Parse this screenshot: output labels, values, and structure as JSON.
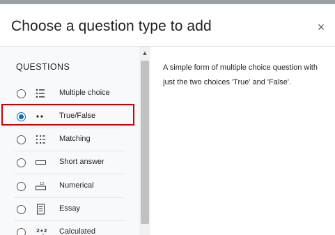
{
  "dialog": {
    "title": "Choose a question type to add",
    "close_glyph": "×"
  },
  "list": {
    "section_label": "QUESTIONS",
    "selected_index": 1,
    "items": [
      {
        "label": "Multiple choice",
        "icon": "list-icon",
        "selected": false
      },
      {
        "label": "True/False",
        "icon": "two-dots-icon",
        "selected": true
      },
      {
        "label": "Matching",
        "icon": "grid-dots-icon",
        "selected": false
      },
      {
        "label": "Short answer",
        "icon": "input-box-icon",
        "selected": false
      },
      {
        "label": "Numerical",
        "icon": "numerical-icon",
        "selected": false
      },
      {
        "label": "Essay",
        "icon": "document-icon",
        "selected": false
      },
      {
        "label": "Calculated",
        "icon": "calculator-icon",
        "selected": false
      }
    ]
  },
  "description": {
    "text": "A simple form of multiple choice question with just the two choices 'True' and 'False'."
  },
  "colors": {
    "accent": "#0f6cbf",
    "highlight": "#cc0000",
    "panel_bg": "#f8f9fa"
  }
}
